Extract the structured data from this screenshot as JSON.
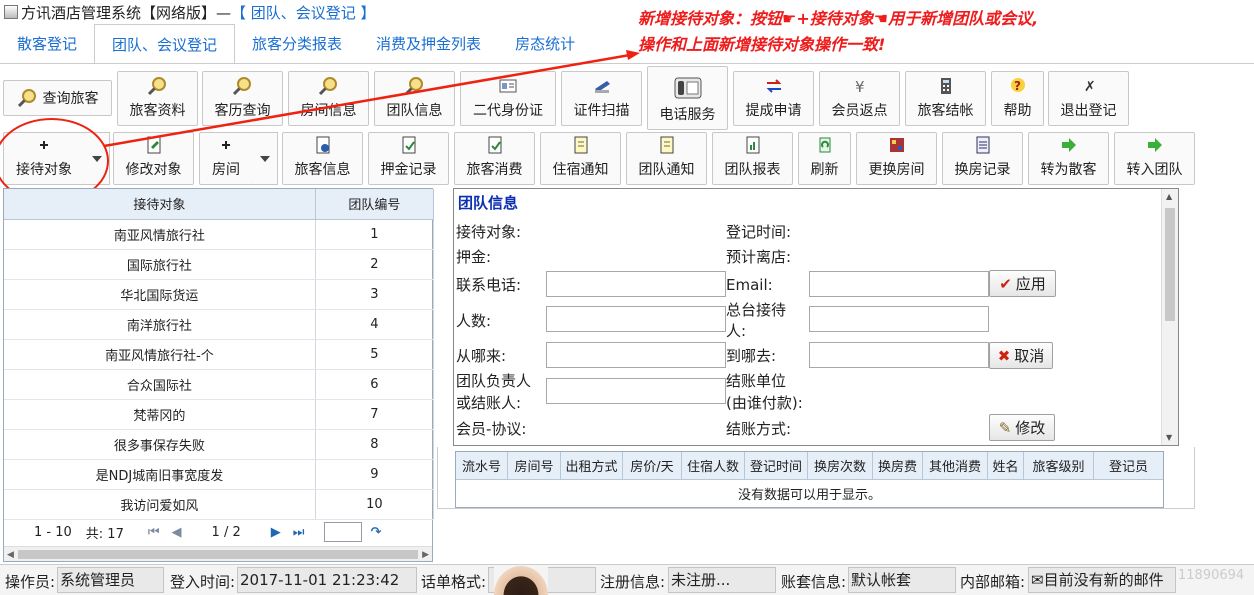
{
  "window": {
    "title_prefix": "方讯酒店管理系统【网络版】— ",
    "title_suffix": "【 团队、会议登记 】"
  },
  "annotation": {
    "line1": "新增接待对象：按钮☛+接待对象☚用于新增团队或会议,",
    "line2": "操作和上面新增接待对象操作一致!"
  },
  "tabs": [
    {
      "label": "散客登记"
    },
    {
      "label": "团队、会议登记"
    },
    {
      "label": "旅客分类报表"
    },
    {
      "label": "消费及押金列表"
    },
    {
      "label": "房态统计"
    }
  ],
  "toolbar1": [
    {
      "label": "查询旅客",
      "icon": "magnifier-icon"
    },
    {
      "label": "旅客资料",
      "icon": "magnifier-icon"
    },
    {
      "label": "客历查询",
      "icon": "magnifier-icon"
    },
    {
      "label": "房间信息",
      "icon": "magnifier-icon"
    },
    {
      "label": "团队信息",
      "icon": "magnifier-icon"
    },
    {
      "label": "二代身份证",
      "icon": "id-card-icon"
    },
    {
      "label": "证件扫描",
      "icon": "scanner-icon"
    },
    {
      "label": "电话服务",
      "icon": "phone-icon"
    },
    {
      "label": "提成申请",
      "icon": "transfer-icon"
    },
    {
      "label": "会员返点",
      "icon": "yen-icon"
    },
    {
      "label": "旅客结帐",
      "icon": "calculator-icon"
    },
    {
      "label": "帮助",
      "icon": "help-icon"
    },
    {
      "label": "退出登记",
      "icon": "exit-icon"
    }
  ],
  "toolbar2": [
    {
      "label": "接待对象",
      "icon": "plus-icon"
    },
    {
      "label": "修改对象",
      "icon": "edit-doc-icon"
    },
    {
      "label": "房间",
      "icon": "plus-icon"
    },
    {
      "label": "旅客信息",
      "icon": "info-doc-icon"
    },
    {
      "label": "押金记录",
      "icon": "doc-icon"
    },
    {
      "label": "旅客消费",
      "icon": "doc-icon"
    },
    {
      "label": "住宿通知",
      "icon": "note-icon"
    },
    {
      "label": "团队通知",
      "icon": "note-icon"
    },
    {
      "label": "团队报表",
      "icon": "report-icon"
    },
    {
      "label": "刷新",
      "icon": "refresh-icon"
    },
    {
      "label": "更换房间",
      "icon": "room-swap-icon"
    },
    {
      "label": "换房记录",
      "icon": "list-icon"
    },
    {
      "label": "转为散客",
      "icon": "green-arrow-icon"
    },
    {
      "label": "转入团队",
      "icon": "green-arrow-icon"
    }
  ],
  "guest_grid": {
    "columns": [
      "接待对象",
      "团队编号"
    ],
    "rows": [
      [
        "南亚风情旅行社",
        "1"
      ],
      [
        "国际旅行社",
        "2"
      ],
      [
        "华北国际货运",
        "3"
      ],
      [
        "南洋旅行社",
        "4"
      ],
      [
        "南亚风情旅行社-个",
        "5"
      ],
      [
        "合众国际社",
        "6"
      ],
      [
        "梵蒂冈的",
        "7"
      ],
      [
        "很多事保存失败",
        "8"
      ],
      [
        "是NDJ城南旧事宽度发",
        "9"
      ],
      [
        "我访问爱如风",
        "10"
      ]
    ],
    "pager": {
      "range": "1 - 10",
      "total": "共: 17",
      "page": "1 / 2",
      "page_input": ""
    }
  },
  "team_panel": {
    "title": "团队信息",
    "labels": {
      "reception": "接待对象:",
      "checkin_time": "登记时间:",
      "deposit": "押金:",
      "expected_leave": "预计离店:",
      "phone": "联系电话:",
      "email": "Email:",
      "headcount": "人数:",
      "front_desk_1": "总台接待",
      "front_desk_2": "人:",
      "from": "从哪来:",
      "to": "到哪去:",
      "leader_1": "团队负责人",
      "leader_2": "或结账人:",
      "payer_1": "结账单位",
      "payer_2": "(由谁付款):",
      "member": "会员-协议:",
      "pay_method": "结账方式:"
    },
    "buttons": {
      "apply": "应用",
      "cancel": "取消",
      "modify": "修改"
    },
    "values": {
      "phone": "",
      "email": "",
      "headcount": "",
      "front_desk": "",
      "from": "",
      "to": "",
      "leader": ""
    }
  },
  "detail_grid": {
    "columns": [
      "流水号",
      "房间号",
      "出租方式",
      "房价/天",
      "住宿人数",
      "登记时间",
      "换房次数",
      "换房费",
      "其他消费",
      "姓名",
      "旅客级别",
      "登记员"
    ],
    "empty_text": "没有数据可以用于显示。"
  },
  "status_bar": {
    "operator_label": "操作员:",
    "operator": "系统管理员",
    "login_label": "登入时间:",
    "login_time": "2017-11-01 21:23:42",
    "bill_format_label": "话单格式:",
    "bill_format": "",
    "register_label": "注册信息:",
    "register": "未注册...",
    "account_label": "账套信息:",
    "account": "默认帐套",
    "mail_label": "内部邮箱:",
    "mail": "目前没有新的邮件",
    "watermark": "11890694"
  },
  "colors": {
    "accent": "#1a6fd1",
    "annotation": "#ee1c1c",
    "panel_title": "#0a2fb0"
  }
}
